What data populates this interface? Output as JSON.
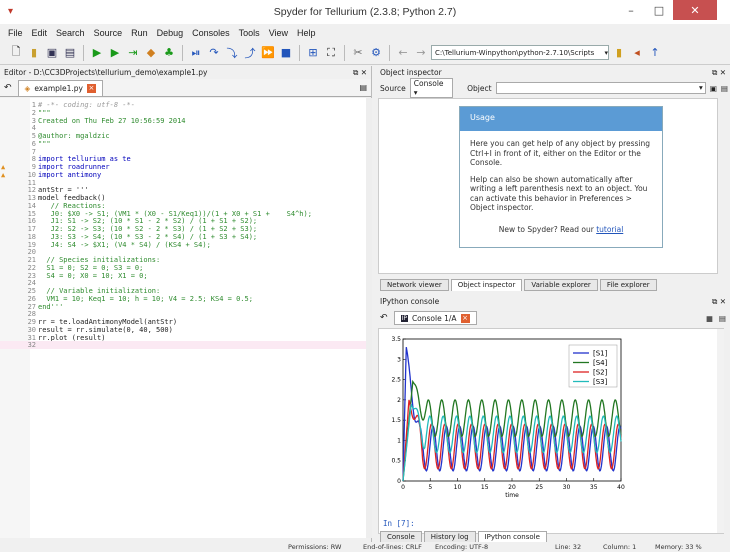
{
  "window": {
    "title": "Spyder for Tellurium (2.3.8; Python 2.7)",
    "minimize": "–",
    "maximize": "□",
    "close": "✕"
  },
  "menu": [
    "File",
    "Edit",
    "Search",
    "Source",
    "Run",
    "Debug",
    "Consoles",
    "Tools",
    "View",
    "Help"
  ],
  "toolbar": {
    "path": "C:\\Tellurium-Winpython\\python-2.7.10\\Scripts"
  },
  "editor": {
    "header": "Editor - D:\\CC3DProjects\\tellurium_demo\\example1.py",
    "tab": "example1.py",
    "lines": [
      {
        "n": "1",
        "t": "# -*- coding: utf-8 -*-",
        "c": "cmt"
      },
      {
        "n": "2",
        "t": "\"\"\"",
        "c": "str"
      },
      {
        "n": "3",
        "t": "Created on Thu Feb 27 10:56:59 2014",
        "c": "str"
      },
      {
        "n": "4",
        "t": "",
        "c": "str"
      },
      {
        "n": "5",
        "t": "@author: mgaldzic",
        "c": "str"
      },
      {
        "n": "6",
        "t": "\"\"\"",
        "c": "str"
      },
      {
        "n": "7",
        "t": "",
        "c": ""
      },
      {
        "n": "8",
        "t": "import tellurium as te",
        "c": "kw"
      },
      {
        "n": "9",
        "t": "import roadrunner",
        "c": "kw",
        "warn": "▲"
      },
      {
        "n": "10",
        "t": "import antimony",
        "c": "kw",
        "warn": "▲"
      },
      {
        "n": "11",
        "t": "",
        "c": ""
      },
      {
        "n": "12",
        "t": "antStr = '''",
        "c": ""
      },
      {
        "n": "13",
        "t": "model feedback()",
        "c": ""
      },
      {
        "n": "14",
        "t": "   // Reactions:",
        "c": "str"
      },
      {
        "n": "15",
        "t": "   J0: $X0 -> S1; (VM1 * (X0 - S1/Keq1))/(1 + X0 + S1 +    S4^h);",
        "c": "str"
      },
      {
        "n": "16",
        "t": "   J1: S1 -> S2; (10 * S1 - 2 * S2) / (1 + S1 + S2);",
        "c": "str"
      },
      {
        "n": "17",
        "t": "   J2: S2 -> S3; (10 * S2 - 2 * S3) / (1 + S2 + S3);",
        "c": "str"
      },
      {
        "n": "18",
        "t": "   J3: S3 -> S4; (10 * S3 - 2 * S4) / (1 + S3 + S4);",
        "c": "str"
      },
      {
        "n": "19",
        "t": "   J4: S4 -> $X1; (V4 * S4) / (KS4 + S4);",
        "c": "str"
      },
      {
        "n": "20",
        "t": "",
        "c": ""
      },
      {
        "n": "21",
        "t": "  // Species initializations:",
        "c": "str"
      },
      {
        "n": "22",
        "t": "  S1 = 0; S2 = 0; S3 = 0;",
        "c": "str"
      },
      {
        "n": "23",
        "t": "  S4 = 0; X0 = 10; X1 = 0;",
        "c": "str"
      },
      {
        "n": "24",
        "t": "",
        "c": ""
      },
      {
        "n": "25",
        "t": "  // Variable initialization:",
        "c": "str"
      },
      {
        "n": "26",
        "t": "  VM1 = 10; Keq1 = 10; h = 10; V4 = 2.5; KS4 = 0.5;",
        "c": "str"
      },
      {
        "n": "27",
        "t": "end'''",
        "c": "str"
      },
      {
        "n": "28",
        "t": "",
        "c": ""
      },
      {
        "n": "29",
        "t": "rr = te.loadAntimonyModel(antStr)",
        "c": ""
      },
      {
        "n": "30",
        "t": "result = rr.simulate(0, 40, 500)",
        "c": ""
      },
      {
        "n": "31",
        "t": "rr.plot (result)",
        "c": ""
      },
      {
        "n": "32",
        "t": "",
        "c": ""
      }
    ]
  },
  "inspector": {
    "header": "Object inspector",
    "source_label": "Source",
    "source_value": "Console",
    "object_label": "Object",
    "usage_title": "Usage",
    "usage_p1": "Here you can get help of any object by pressing Ctrl+I in front of it, either on the Editor or the Console.",
    "usage_p2": "Help can also be shown automatically after writing a left parenthesis next to an object. You can activate this behavior in Preferences > Object inspector.",
    "usage_p3_pre": "New to Spyder? Read our ",
    "usage_p3_link": "tutorial",
    "tabs": [
      "Network viewer",
      "Object inspector",
      "Variable explorer",
      "File explorer"
    ]
  },
  "ipython": {
    "header": "IPython console",
    "tab": "Console 1/A",
    "prompt": "In [7]:",
    "tabs": [
      "Console",
      "History log",
      "IPython console"
    ]
  },
  "chart_data": {
    "type": "line",
    "xlabel": "time",
    "xlim": [
      0,
      40
    ],
    "ylim": [
      0,
      3.5
    ],
    "xticks": [
      0,
      5,
      10,
      15,
      20,
      25,
      30,
      35,
      40
    ],
    "yticks": [
      0.0,
      0.5,
      1.0,
      1.5,
      2.0,
      2.5,
      3.0,
      3.5
    ],
    "series": [
      {
        "name": "[S1]",
        "color": "#2233cc",
        "amp": 0.55,
        "base": 0.8,
        "peak": 3.3,
        "peak_t": 0.6,
        "phase": 0.0
      },
      {
        "name": "[S4]",
        "color": "#227722",
        "amp": 0.45,
        "base": 1.55,
        "peak": 2.45,
        "peak_t": 1.8,
        "phase": 2.2
      },
      {
        "name": "[S2]",
        "color": "#dd2222",
        "amp": 0.55,
        "base": 0.85,
        "peak": 2.0,
        "peak_t": 1.1,
        "phase": 0.8
      },
      {
        "name": "[S3]",
        "color": "#22bbbb",
        "amp": 0.45,
        "base": 1.15,
        "peak": 1.9,
        "peak_t": 1.5,
        "phase": 1.5
      }
    ],
    "period": 2.45,
    "legend": "top-right"
  },
  "status": {
    "permissions": "Permissions: RW",
    "eol": "End-of-lines: CRLF",
    "encoding": "Encoding: UTF-8",
    "line": "Line: 32",
    "column": "Column: 1",
    "memory": "Memory: 33 %"
  }
}
